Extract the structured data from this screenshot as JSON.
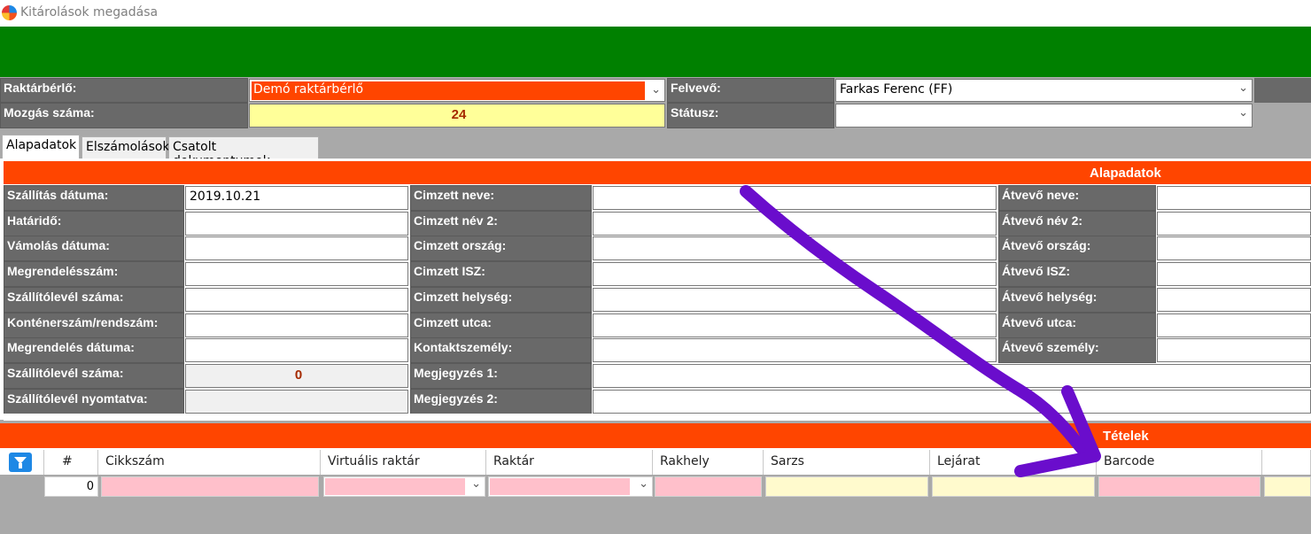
{
  "window": {
    "title": "Kitárolások megadása"
  },
  "header": {
    "raktarberlo_label": "Raktárbérlő:",
    "raktarberlo_value": "Demó raktárbérlő",
    "mozgas_label": "Mozgás száma:",
    "mozgas_value": "24",
    "felvevo_label": "Felvevő:",
    "felvevo_value": "Farkas Ferenc (FF)",
    "statusz_label": "Státusz:",
    "statusz_value": ""
  },
  "tabs": [
    "Alapadatok",
    "Elszámolások",
    "Csatolt dokumentumok"
  ],
  "alapadatok": {
    "section_title": "Alapadatok",
    "col1": [
      {
        "label": "Szállítás dátuma:",
        "value": "2019.10.21"
      },
      {
        "label": "Határidő:",
        "value": ""
      },
      {
        "label": "Vámolás dátuma:",
        "value": ""
      },
      {
        "label": "Megrendelésszám:",
        "value": ""
      },
      {
        "label": "Szállítólevél száma:",
        "value": ""
      },
      {
        "label": "Konténerszám/rendszám:",
        "value": ""
      },
      {
        "label": "Megrendelés dátuma:",
        "value": ""
      },
      {
        "label": "Szállítólevél száma:",
        "value": "0"
      },
      {
        "label": "Szállítólevél nyomtatva:",
        "value": ""
      }
    ],
    "col2": [
      {
        "label": "Cimzett neve:",
        "value": ""
      },
      {
        "label": "Cimzett név 2:",
        "value": ""
      },
      {
        "label": "Cimzett ország:",
        "value": ""
      },
      {
        "label": "Cimzett ISZ:",
        "value": ""
      },
      {
        "label": "Cimzett helység:",
        "value": ""
      },
      {
        "label": "Cimzett utca:",
        "value": ""
      },
      {
        "label": "Kontaktszemély:",
        "value": ""
      },
      {
        "label": "Megjegyzés 1:",
        "value": ""
      },
      {
        "label": "Megjegyzés 2:",
        "value": ""
      }
    ],
    "col3": [
      {
        "label": "Átvevő neve:",
        "value": ""
      },
      {
        "label": "Átvevő név 2:",
        "value": ""
      },
      {
        "label": "Átvevő ország:",
        "value": ""
      },
      {
        "label": "Átvevő ISZ:",
        "value": ""
      },
      {
        "label": "Átvevő helység:",
        "value": ""
      },
      {
        "label": "Átvevő utca:",
        "value": ""
      },
      {
        "label": "Átvevő személy:",
        "value": ""
      }
    ]
  },
  "tetelek": {
    "section_title": "Tételek",
    "columns": [
      "#",
      "Cikkszám",
      "Virtuális raktár",
      "Raktár",
      "Rakhely",
      "Sarzs",
      "Lejárat",
      "Barcode"
    ],
    "row": {
      "index": "0"
    }
  },
  "colors": {
    "green": "#008000",
    "orange": "#ff4500",
    "label_gray": "#696969",
    "highlight_yellow": "#ffff99",
    "required_pink": "#ffc0cb",
    "optional_cream": "#fffacd",
    "annotation_purple": "#6a0dcc"
  },
  "icons": {
    "filter": "filter-icon",
    "dropdown": "chevron-down-icon",
    "app": "app-logo-icon"
  }
}
